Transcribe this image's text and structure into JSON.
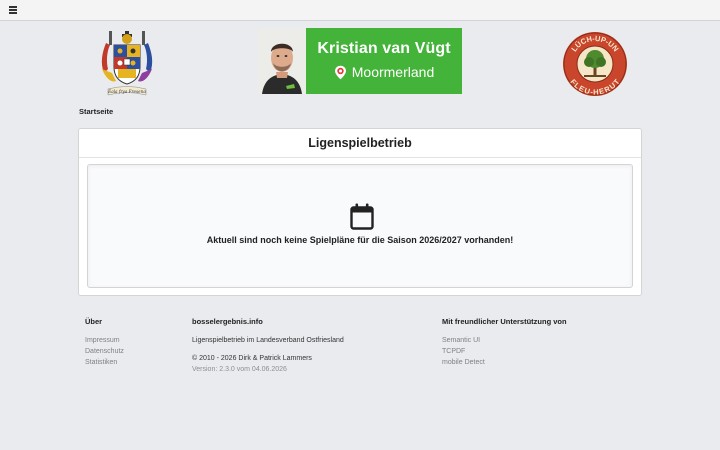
{
  "topbar": {
    "menu_icon": "hamburger-menu-icon"
  },
  "header": {
    "crest_motto": "Eala frya Fresena",
    "banner": {
      "name": "Kristian van Vügt",
      "location": "Moormerland",
      "color": "#43b339"
    },
    "seal_text": "LÜCH-UP-UN-FLEU-HERUT"
  },
  "breadcrumb": {
    "home": "Startseite"
  },
  "main": {
    "title": "Ligenspielbetrieb",
    "message": "Aktuell sind noch keine Spielpläne für die Saison 2026/2027 vorhanden!"
  },
  "footer": {
    "about": {
      "title": "Über",
      "links": [
        "Impressum",
        "Datenschutz",
        "Statistiken"
      ]
    },
    "site": {
      "title": "bosselergebnis.info",
      "desc": "Ligenspielbetrieb im Landesverband Ostfriesland",
      "copyright": "© 2010 - 2026 Dirk & Patrick Lammers",
      "version": "Version: 2.3.0 vom 04.06.2026"
    },
    "support": {
      "title": "Mit freundlicher Unterstützung von",
      "links": [
        "Semantic UI",
        "TCPDF",
        "mobile Detect"
      ]
    }
  }
}
